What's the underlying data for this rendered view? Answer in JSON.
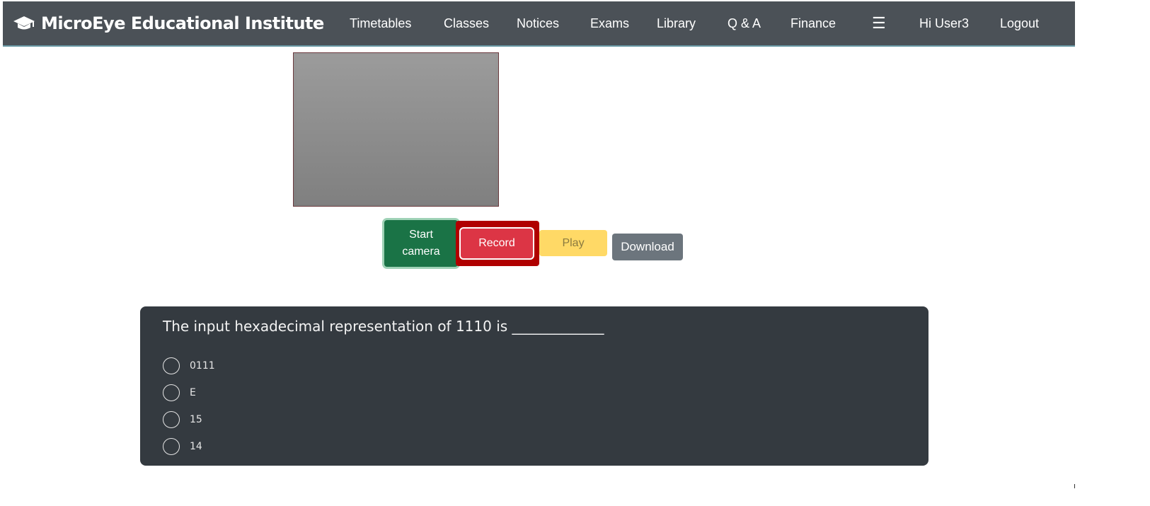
{
  "brand": {
    "title": "MicroEye Educational Institute",
    "icon": "graduation-cap-icon"
  },
  "nav": {
    "items": [
      "Timetables",
      "Classes",
      "Notices",
      "Exams",
      "Library",
      "Q & A",
      "Finance"
    ],
    "menu_icon": "hamburger-menu-icon",
    "user_greeting": "Hi User3",
    "logout": "Logout"
  },
  "camera": {
    "start_label_line1": "Start",
    "start_label_line2": "camera",
    "record_label": "Record",
    "play_label": "Play",
    "download_label": "Download"
  },
  "question": {
    "text": "The input hexadecimal representation of 1110 is _____________",
    "options": [
      "0111",
      "E",
      "15",
      "14"
    ]
  },
  "colors": {
    "navbar": "#4b5157",
    "start": "#1a7346",
    "record": "#dc3545",
    "record_frame": "#b00000",
    "play": "#ffd966",
    "download": "#6c757d",
    "card": "#343a40"
  }
}
